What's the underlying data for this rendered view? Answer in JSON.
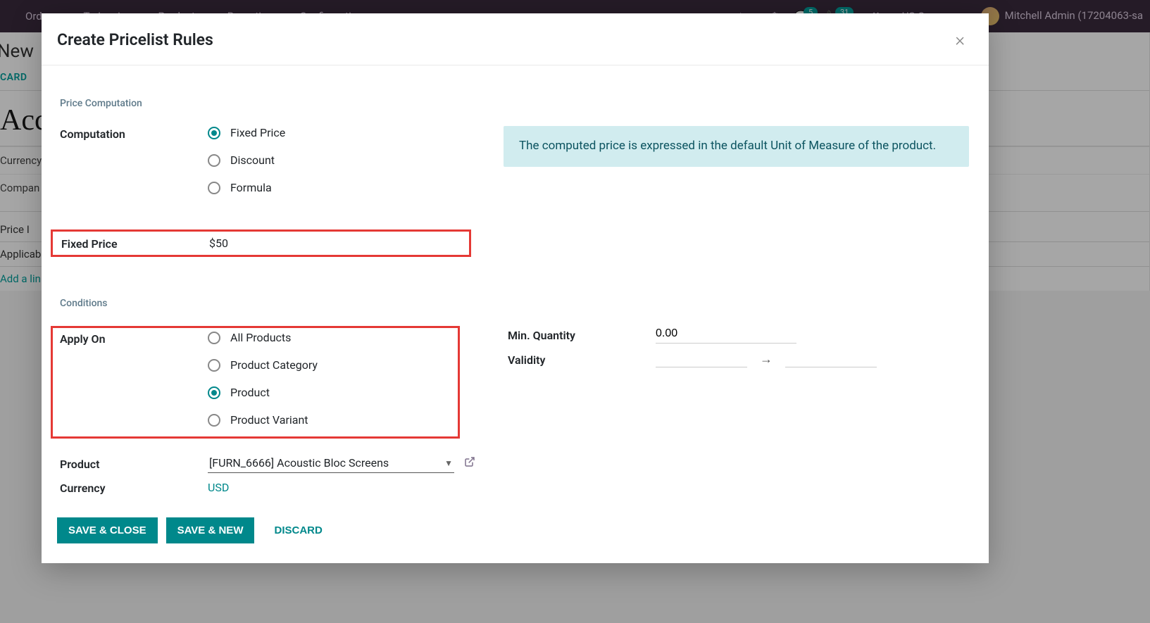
{
  "background": {
    "nav": {
      "orders": "Orders",
      "to_invoice": "To Invoice",
      "products": "Products",
      "reporting": "Reporting",
      "configuration": "Configuration"
    },
    "nav_right": {
      "badge1": "5",
      "badge2": "31",
      "company": "US Company",
      "user": "Mitchell Admin (17204063-sa"
    },
    "new_label": "New",
    "tab": "CARD",
    "title": "Acc",
    "row1": "Currency",
    "row2": "Compan",
    "tab2_a": "Price I",
    "tab2_b": "Applicab",
    "addline": "Add a lin"
  },
  "modal": {
    "title": "Create Pricelist Rules",
    "sections": {
      "price_comp": "Price Computation",
      "conditions": "Conditions"
    },
    "labels": {
      "computation": "Computation",
      "fixed_price": "Fixed Price",
      "apply_on": "Apply On",
      "min_qty": "Min. Quantity",
      "validity": "Validity",
      "product": "Product",
      "currency": "Currency"
    },
    "radios": {
      "comp": {
        "fixed": "Fixed Price",
        "discount": "Discount",
        "formula": "Formula"
      },
      "apply": {
        "all": "All Products",
        "pcat": "Product Category",
        "product": "Product",
        "variant": "Product Variant"
      }
    },
    "info": "The computed price is expressed in the default Unit of Measure of the product.",
    "values": {
      "fixed_price": "$50",
      "min_qty": "0.00",
      "product": "[FURN_6666] Acoustic Bloc Screens",
      "currency": "USD"
    },
    "footer": {
      "save_close": "SAVE & CLOSE",
      "save_new": "SAVE & NEW",
      "discard": "DISCARD"
    }
  }
}
